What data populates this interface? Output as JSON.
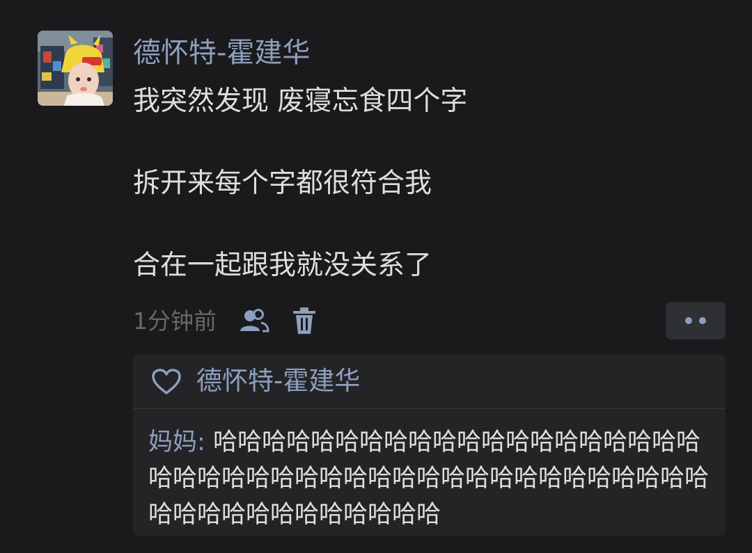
{
  "post": {
    "author": "德怀特-霍建华",
    "lines": [
      "我突然发现 废寝忘食四个字",
      "拆开来每个字都很符合我",
      "合在一起跟我就没关系了"
    ],
    "timestamp": "1分钟前",
    "icons": {
      "visibility": "friends-visibility-icon",
      "delete": "trash-icon",
      "more": "more-dots-icon",
      "like": "heart-icon"
    }
  },
  "likes": {
    "names": "德怀特-霍建华"
  },
  "comment": {
    "author": "妈妈",
    "separator": ": ",
    "text": "哈哈哈哈哈哈哈哈哈哈哈哈哈哈哈哈哈哈哈哈哈哈哈哈哈哈哈哈哈哈哈哈哈哈哈哈哈哈哈哈哈哈哈哈哈哈哈哈哈哈哈哈哈哈哈"
  },
  "colors": {
    "background": "#1a1a1c",
    "name_blue": "#8d9fbe",
    "text": "#dedede",
    "muted": "#676767",
    "panel": "#242427"
  }
}
